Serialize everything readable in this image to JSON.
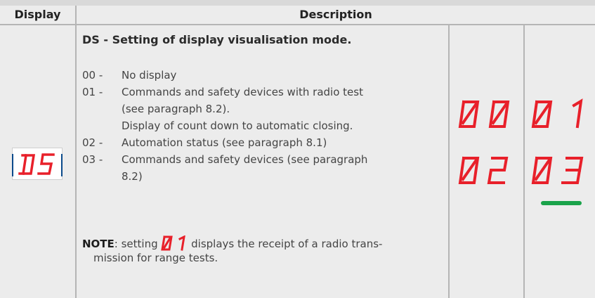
{
  "header": {
    "display": "Display",
    "description": "Description"
  },
  "row": {
    "display_code": "DS",
    "title": "DS - Setting of display visualisation mode.",
    "options": [
      {
        "code": "00 -",
        "lines": [
          "No display"
        ]
      },
      {
        "code": "01 -",
        "lines": [
          "Commands and safety devices with radio test",
          "(see paragraph 8.2).",
          "Display of count down to automatic closing."
        ]
      },
      {
        "code": "02 -",
        "lines": [
          "Automation status (see paragraph 8.1)"
        ]
      },
      {
        "code": "03 -",
        "lines": [
          "Commands and safety devices (see paragraph",
          "8.2)"
        ]
      }
    ],
    "note": {
      "label": "NOTE",
      "before": ": setting ",
      "value": "01",
      "after": " displays the receipt of a radio trans-",
      "continuation": "mission for range tests."
    }
  },
  "segment_values": {
    "top_left": "00",
    "top_right": "01",
    "bottom_left": "02",
    "bottom_right": "03"
  },
  "selected_value": "03",
  "colors": {
    "segment": "#e8202a",
    "selected_bar": "#1aa34a",
    "panel": "#ececec",
    "rule": "#b5b5b5"
  }
}
